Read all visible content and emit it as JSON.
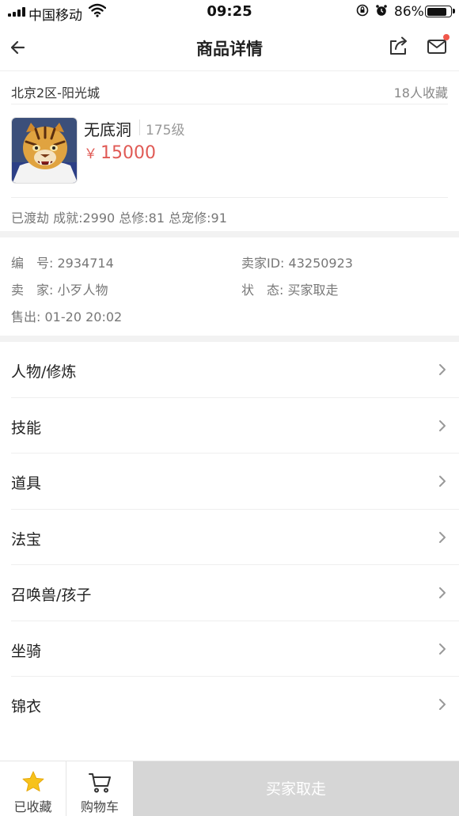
{
  "status_bar": {
    "carrier": "中国移动",
    "time": "09:25",
    "battery": "86%",
    "battery_level": 0.86
  },
  "nav": {
    "title": "商品详情",
    "back_icon": "arrow-left-icon",
    "share_icon": "share-icon",
    "mail_icon": "mail-icon",
    "notification_color": "#f0574b"
  },
  "server": {
    "name": "北京2区-阳光城",
    "favorites": "18人收藏"
  },
  "product": {
    "name": "无底洞",
    "level": "175级",
    "currency": "￥",
    "price": "15000",
    "price_color": "#e05a55",
    "stats": "已渡劫 成就:2990 总修:81 总宠修:91"
  },
  "details": {
    "id_label": "编　号:",
    "id_value": "2934714",
    "seller_id_label": "卖家ID:",
    "seller_id_value": "43250923",
    "seller_label": "卖　家:",
    "seller_value": "小歹人物",
    "status_label": "状　态:",
    "status_value": "买家取走",
    "sold_label": "售出:",
    "sold_value": "01-20 20:02"
  },
  "menu": [
    {
      "label": "人物/修炼"
    },
    {
      "label": "技能"
    },
    {
      "label": "道具"
    },
    {
      "label": "法宝"
    },
    {
      "label": "召唤兽/孩子"
    },
    {
      "label": "坐骑"
    },
    {
      "label": "锦衣"
    }
  ],
  "bottom_bar": {
    "favorite_label": "已收藏",
    "favorite_icon": "star-icon",
    "favorite_color": "#f7c21b",
    "cart_label": "购物车",
    "cart_icon": "cart-icon",
    "buy_label": "买家取走"
  }
}
